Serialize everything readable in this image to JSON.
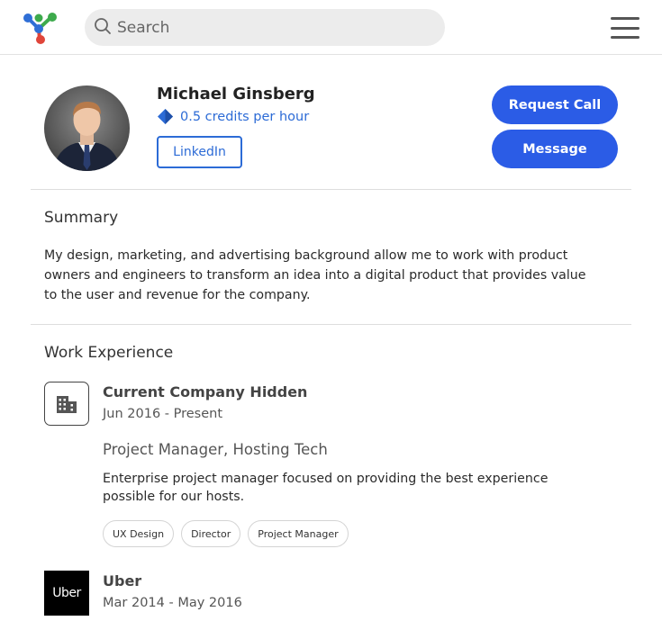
{
  "header": {
    "search_placeholder": "Search"
  },
  "profile": {
    "name": "Michael Ginsberg",
    "credits": "0.5 credits per hour",
    "linkedin_label": "LinkedIn",
    "request_call_label": "Request Call",
    "message_label": "Message"
  },
  "summary": {
    "title": "Summary",
    "text": "My design, marketing, and advertising background allow me to work with product owners and engineers to transform an idea into a digital product that provides value to the user and revenue for the company."
  },
  "work": {
    "title": "Work Experience",
    "jobs": [
      {
        "company": "Current Company Hidden",
        "dates": "Jun 2016 - Present",
        "role": "Project Manager, Hosting Tech",
        "description": "Enterprise project manager focused on providing the best experience possible for our hosts.",
        "tags": [
          "UX Design",
          "Director",
          "Project Manager"
        ]
      },
      {
        "company": "Uber",
        "logo_text": "Uber",
        "dates": "Mar 2014 - May 2016"
      }
    ]
  },
  "colors": {
    "accent": "#2b5ce6",
    "link": "#2c6bd6",
    "logo_blue": "#2f6fd6",
    "logo_green": "#3daa4c",
    "logo_red": "#e0453a"
  },
  "icons": {
    "logo": "app-logo-icon",
    "search": "search-icon",
    "menu": "hamburger-menu-icon",
    "credits": "diamond-tag-icon",
    "company": "building-icon"
  }
}
